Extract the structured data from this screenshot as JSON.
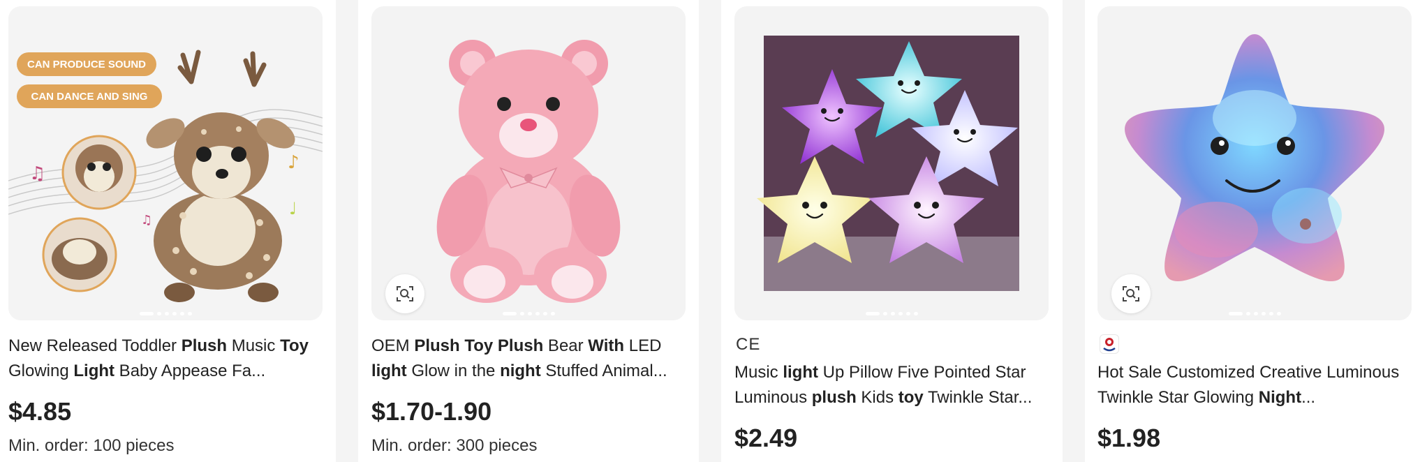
{
  "products": [
    {
      "title_parts": [
        {
          "t": "New Released Toddler ",
          "b": false
        },
        {
          "t": "Plush",
          "b": true
        },
        {
          "t": " Music ",
          "b": false
        },
        {
          "t": "Toy",
          "b": true
        },
        {
          "t": " Glowing ",
          "b": false
        },
        {
          "t": "Light",
          "b": true
        },
        {
          "t": " Baby Appease Fa...",
          "b": false
        }
      ],
      "badges": [
        "CAN PRODUCE SOUND",
        "CAN DANCE AND SING"
      ],
      "price": "$4.85",
      "moq": "Min. order: 100 pieces",
      "image_icon": "deer-plush-image"
    },
    {
      "title_parts": [
        {
          "t": "OEM ",
          "b": false
        },
        {
          "t": "Plush Toy Plush",
          "b": true
        },
        {
          "t": " Bear ",
          "b": false
        },
        {
          "t": "With",
          "b": true
        },
        {
          "t": " LED ",
          "b": false
        },
        {
          "t": "light",
          "b": true
        },
        {
          "t": " Glow in the ",
          "b": false
        },
        {
          "t": "night",
          "b": true
        },
        {
          "t": " Stuffed Animal...",
          "b": false
        }
      ],
      "price": "$1.70-1.90",
      "moq": "Min. order: 300 pieces",
      "image_icon": "pink-bear-image"
    },
    {
      "cert": "CE",
      "title_parts": [
        {
          "t": "Music ",
          "b": false
        },
        {
          "t": "light",
          "b": true
        },
        {
          "t": " Up Pillow Five Pointed Star Luminous ",
          "b": false
        },
        {
          "t": "plush",
          "b": true
        },
        {
          "t": " Kids ",
          "b": false
        },
        {
          "t": "toy",
          "b": true
        },
        {
          "t": " Twinkle Star...",
          "b": false
        }
      ],
      "price": "$2.49",
      "image_icon": "star-pillows-image"
    },
    {
      "title_parts": [
        {
          "t": "Hot Sale Customized Creative Luminous Twinkle Star Glowing ",
          "b": false
        },
        {
          "t": "Night",
          "b": true
        },
        {
          "t": "...",
          "b": false
        }
      ],
      "price": "$1.98",
      "image_icon": "star-pillow-image",
      "supplier_icon": "supplier-logo-icon"
    }
  ],
  "colors": {
    "badge": "#e0a55a",
    "card_bg": "#f3f3f3",
    "gap": "#f4f4f4",
    "text": "#222222"
  }
}
